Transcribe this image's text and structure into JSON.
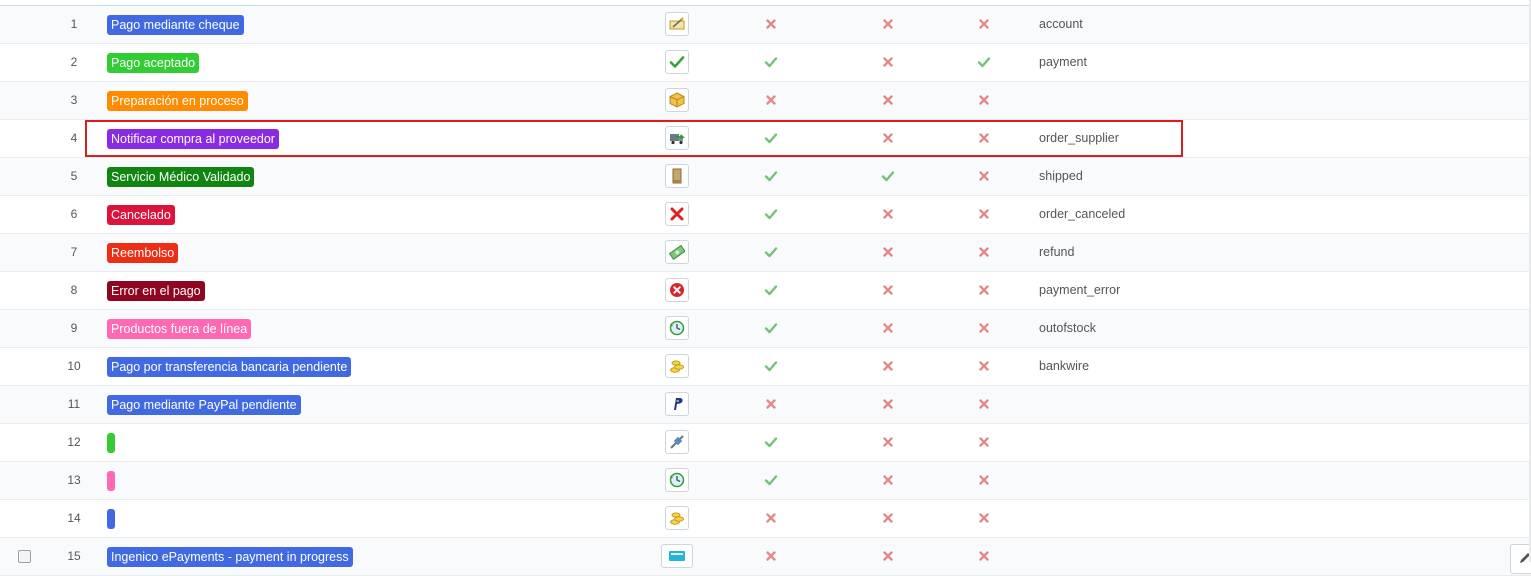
{
  "colors": {
    "check": "#72c279",
    "cross": "#e08a8a",
    "highlight_border": "#d81e1e"
  },
  "rows": [
    {
      "id": "1",
      "label": "Pago mediante cheque",
      "color": "#4169e1",
      "icon": "cheque-icon",
      "col1": "cross",
      "col2": "cross",
      "col3": "cross",
      "template": "account"
    },
    {
      "id": "2",
      "label": "Pago aceptado",
      "color": "#32cd32",
      "icon": "checkmark-icon",
      "col1": "check",
      "col2": "cross",
      "col3": "check",
      "template": "payment"
    },
    {
      "id": "3",
      "label": "Preparación en proceso",
      "color": "#ff8c00",
      "icon": "package-icon",
      "col1": "cross",
      "col2": "cross",
      "col3": "cross",
      "template": ""
    },
    {
      "id": "4",
      "label": "Notificar compra al proveedor",
      "color": "#8a2be2",
      "icon": "truck-icon",
      "col1": "check",
      "col2": "cross",
      "col3": "cross",
      "template": "order_supplier"
    },
    {
      "id": "5",
      "label": "Servicio Médico Validado",
      "color": "#108510",
      "icon": "box-icon",
      "col1": "check",
      "col2": "check",
      "col3": "cross",
      "template": "shipped"
    },
    {
      "id": "6",
      "label": "Cancelado",
      "color": "#dc143c",
      "icon": "red-x-icon",
      "col1": "check",
      "col2": "cross",
      "col3": "cross",
      "template": "order_canceled"
    },
    {
      "id": "7",
      "label": "Reembolso",
      "color": "#ec2e15",
      "icon": "money-icon",
      "col1": "check",
      "col2": "cross",
      "col3": "cross",
      "template": "refund"
    },
    {
      "id": "8",
      "label": "Error en el pago",
      "color": "#8f0621",
      "icon": "error-circle-icon",
      "col1": "check",
      "col2": "cross",
      "col3": "cross",
      "template": "payment_error"
    },
    {
      "id": "9",
      "label": "Productos fuera de línea",
      "color": "#ff69b4",
      "icon": "clock-arrows-icon",
      "col1": "check",
      "col2": "cross",
      "col3": "cross",
      "template": "outofstock"
    },
    {
      "id": "10",
      "label": "Pago por transferencia bancaria pendiente",
      "color": "#4169e1",
      "icon": "coins-icon",
      "col1": "check",
      "col2": "cross",
      "col3": "cross",
      "template": "bankwire"
    },
    {
      "id": "11",
      "label": "Pago mediante PayPal pendiente",
      "color": "#4169e1",
      "icon": "paypal-icon",
      "col1": "cross",
      "col2": "cross",
      "col3": "cross",
      "template": ""
    },
    {
      "id": "12",
      "label": "",
      "color": "#32cd32",
      "icon": "connector-icon",
      "col1": "check",
      "col2": "cross",
      "col3": "cross",
      "template": ""
    },
    {
      "id": "13",
      "label": "",
      "color": "#ff69b4",
      "icon": "clock-arrows-icon",
      "col1": "check",
      "col2": "cross",
      "col3": "cross",
      "template": ""
    },
    {
      "id": "14",
      "label": "",
      "color": "#4169e1",
      "icon": "coins-icon",
      "col1": "cross",
      "col2": "cross",
      "col3": "cross",
      "template": ""
    },
    {
      "id": "15",
      "label": "Ingenico ePayments - payment in progress",
      "color": "#4169e1",
      "icon": "ingenico-icon",
      "col1": "cross",
      "col2": "cross",
      "col3": "cross",
      "template": ""
    }
  ]
}
